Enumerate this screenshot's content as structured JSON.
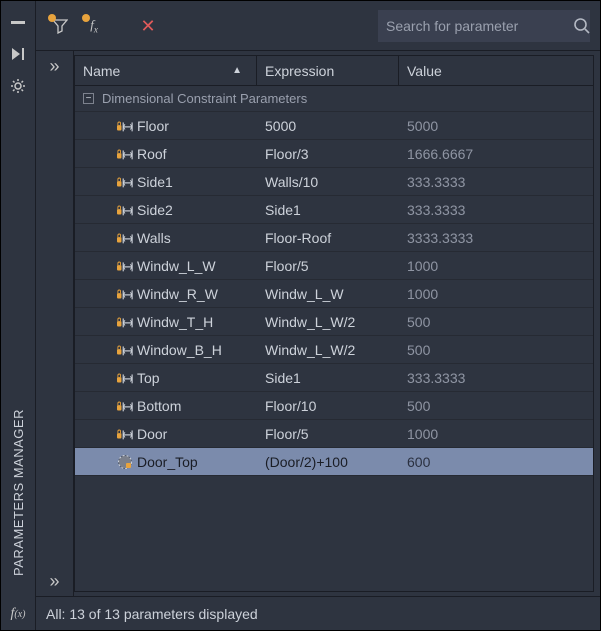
{
  "rail": {
    "title": "PARAMETERS MANAGER"
  },
  "search": {
    "placeholder": "Search for parameter"
  },
  "columns": {
    "name": "Name",
    "expression": "Expression",
    "value": "Value"
  },
  "group": {
    "label": "Dimensional Constraint Parameters"
  },
  "params": [
    {
      "icon": "locked-linear",
      "name": "Floor",
      "expression": "5000",
      "value": "5000"
    },
    {
      "icon": "locked-linear",
      "name": "Roof",
      "expression": "Floor/3",
      "value": "1666.6667"
    },
    {
      "icon": "locked-linear",
      "name": "Side1",
      "expression": "Walls/10",
      "value": "333.3333"
    },
    {
      "icon": "locked-linear",
      "name": "Side2",
      "expression": "Side1",
      "value": "333.3333"
    },
    {
      "icon": "locked-linear",
      "name": "Walls",
      "expression": "Floor-Roof",
      "value": "3333.3333"
    },
    {
      "icon": "locked-linear",
      "name": "Windw_L_W",
      "expression": "Floor/5",
      "value": "1000"
    },
    {
      "icon": "locked-linear",
      "name": "Windw_R_W",
      "expression": "Windw_L_W",
      "value": "1000"
    },
    {
      "icon": "locked-linear",
      "name": "Windw_T_H",
      "expression": "Windw_L_W/2",
      "value": "500"
    },
    {
      "icon": "locked-linear",
      "name": "Window_B_H",
      "expression": "Windw_L_W/2",
      "value": "500"
    },
    {
      "icon": "locked-linear",
      "name": "Top",
      "expression": "Side1",
      "value": "333.3333"
    },
    {
      "icon": "locked-linear",
      "name": "Bottom",
      "expression": "Floor/10",
      "value": "500"
    },
    {
      "icon": "locked-linear",
      "name": "Door",
      "expression": "Floor/5",
      "value": "1000"
    },
    {
      "icon": "dynamic",
      "name": "Door_Top",
      "expression": "(Door/2)+100",
      "value": "600",
      "selected": true
    }
  ],
  "status": "All: 13 of 13 parameters displayed"
}
